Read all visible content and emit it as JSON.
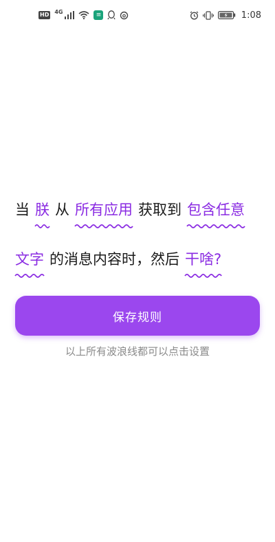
{
  "status_bar": {
    "hd": "HD",
    "network": "4G",
    "app_badge": "≡",
    "time": "1:08"
  },
  "rule": {
    "line1": {
      "prefix": "当",
      "who": "朕",
      "from": "从",
      "apps": "所有应用",
      "get": "获取到",
      "text_a": "包含任意"
    },
    "line2": {
      "text_b": "文字",
      "middle": "的消息内容时，然后",
      "action": "干啥?"
    }
  },
  "save_button": {
    "label": "保存规则"
  },
  "hint": "以上所有波浪线都可以点击设置",
  "colors": {
    "accent": "#9b47ee",
    "wavy_text": "#8a2be2",
    "hint": "#8a8a8a"
  }
}
